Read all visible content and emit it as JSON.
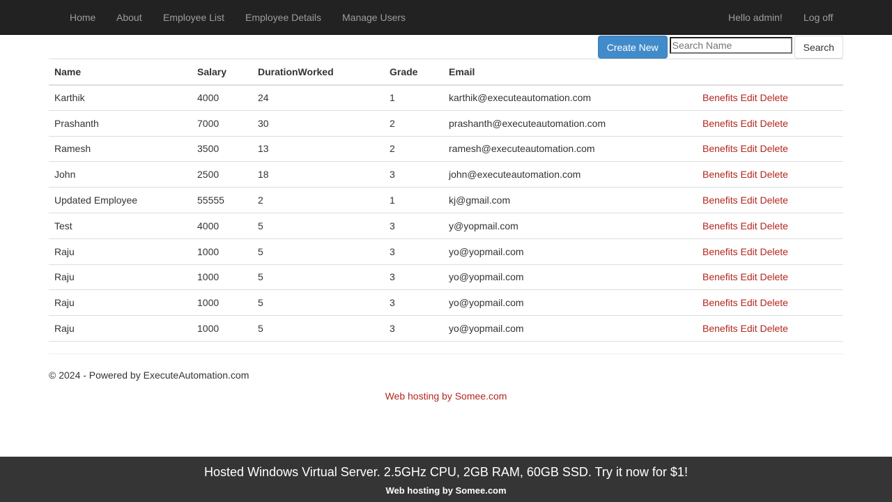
{
  "nav": {
    "items": [
      "Home",
      "About",
      "Employee List",
      "Employee Details",
      "Manage Users"
    ],
    "greeting": "Hello admin!",
    "logoff": "Log off"
  },
  "toolbar": {
    "create": "Create New",
    "search_placeholder": "Search Name",
    "search": "Search"
  },
  "table": {
    "headers": [
      "Name",
      "Salary",
      "DurationWorked",
      "Grade",
      "Email"
    ],
    "rows": [
      [
        "Karthik",
        "4000",
        "24",
        "1",
        "karthik@executeautomation.com"
      ],
      [
        "Prashanth",
        "7000",
        "30",
        "2",
        "prashanth@executeautomation.com"
      ],
      [
        "Ramesh",
        "3500",
        "13",
        "2",
        "ramesh@executeautomation.com"
      ],
      [
        "John",
        "2500",
        "18",
        "3",
        "john@executeautomation.com"
      ],
      [
        "Updated Employee",
        "55555",
        "2",
        "1",
        "kj@gmail.com"
      ],
      [
        "Test",
        "4000",
        "5",
        "3",
        "y@yopmail.com"
      ],
      [
        "Raju",
        "1000",
        "5",
        "3",
        "yo@yopmail.com"
      ],
      [
        "Raju",
        "1000",
        "5",
        "3",
        "yo@yopmail.com"
      ],
      [
        "Raju",
        "1000",
        "5",
        "3",
        "yo@yopmail.com"
      ],
      [
        "Raju",
        "1000",
        "5",
        "3",
        "yo@yopmail.com"
      ]
    ],
    "actions": [
      "Benefits",
      "Edit",
      "Delete"
    ]
  },
  "footer": {
    "copyright": "© 2024 - Powered by ExecuteAutomation.com",
    "hosting": "Web hosting by Somee.com"
  },
  "banner": {
    "ad": "Hosted Windows Virtual Server. 2.5GHz CPU, 2GB RAM, 60GB SSD. Try it now for $1!",
    "hosting": "Web hosting by Somee.com"
  }
}
